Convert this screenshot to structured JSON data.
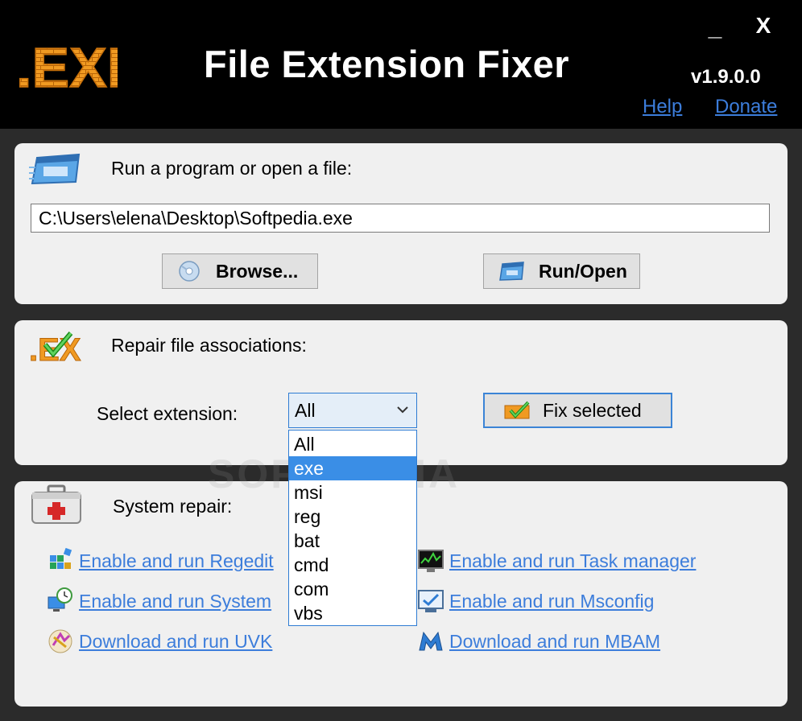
{
  "header": {
    "logo_text": ".EXE",
    "title": "File Extension Fixer",
    "version": "v1.9.0.0",
    "minimize_label": "_",
    "close_label": "X",
    "help_label": "Help",
    "donate_label": "Donate"
  },
  "run_section": {
    "title": "Run a program or open a file:",
    "path_value": "C:\\Users\\elena\\Desktop\\Softpedia.exe",
    "browse_label": "Browse...",
    "run_label": "Run/Open"
  },
  "repair_section": {
    "title": "Repair file associations:",
    "select_label": "Select extension:",
    "selected_value": "All",
    "fix_label": "Fix selected",
    "options": [
      "All",
      "exe",
      "msi",
      "reg",
      "bat",
      "cmd",
      "com",
      "vbs"
    ],
    "highlighted_option": "exe"
  },
  "system_section": {
    "title": "System repair:",
    "links": {
      "regedit": "Enable and run Regedit",
      "system_restore": "Enable and run System",
      "uvk": "Download and run UVK",
      "task_manager": "Enable and run Task manager",
      "msconfig": "Enable and run Msconfig",
      "mbam": "Download and run MBAM"
    }
  },
  "watermark": "SOFTPEDIA",
  "colors": {
    "link": "#3c7ddb",
    "accent": "#2e7cd3",
    "highlight": "#3a8ee6",
    "logo_orange": "#e88a1a"
  }
}
